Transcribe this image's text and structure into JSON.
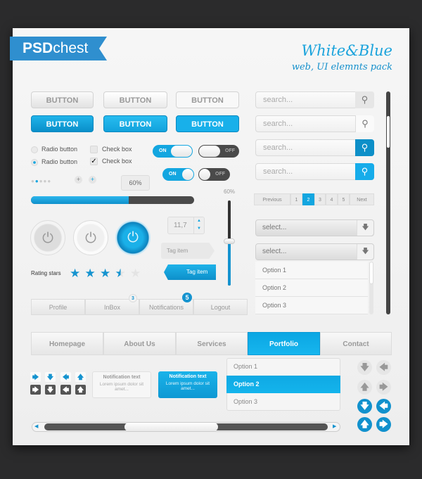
{
  "brand": {
    "logo_bold": "PSD",
    "logo_light": "chest",
    "title": "White&Blue",
    "subtitle": "web, UI elemnts pack"
  },
  "buttons": {
    "label": "BUTTON"
  },
  "search": {
    "placeholder": "search..."
  },
  "radios": [
    {
      "label": "Radio button",
      "checked": false
    },
    {
      "label": "Radio button",
      "checked": true
    }
  ],
  "checkboxes": [
    {
      "label": "Check box",
      "checked": false
    },
    {
      "label": "Check box",
      "checked": true
    }
  ],
  "toggles": {
    "on": "ON",
    "off": "OFF"
  },
  "progress": {
    "tooltip": "60%",
    "value": 60
  },
  "vslider": {
    "label": "60%",
    "value": 60
  },
  "pagination": {
    "prev": "Previous",
    "pages": [
      "1",
      "2",
      "3",
      "4",
      "5"
    ],
    "active": "2",
    "next": "Next"
  },
  "stepper": {
    "value": "11,7"
  },
  "tags": [
    "Tag item",
    "Tag item"
  ],
  "rating": {
    "label": "Rating stars",
    "value": 3.5,
    "max": 5
  },
  "selects": [
    "select...",
    "select..."
  ],
  "options": [
    "Option 1",
    "Option 2",
    "Option 3"
  ],
  "tabs": [
    {
      "label": "Profile"
    },
    {
      "label": "InBox",
      "badge": "3"
    },
    {
      "label": "Notifications",
      "badge": "5"
    },
    {
      "label": "Logout"
    }
  ],
  "nav": {
    "items": [
      "Homepage",
      "About Us",
      "Services",
      "Portfolio",
      "Contact"
    ],
    "active": "Portfolio"
  },
  "notifications": [
    {
      "title": "Notification text",
      "body": "Lorem ipsum dolor sit amet..."
    },
    {
      "title": "Notification text",
      "body": "Lorem ipsum dolor sit amet..."
    }
  ],
  "dropdown": {
    "options": [
      "Option 1",
      "Option 2",
      "Option 3"
    ],
    "selected": "Option 2"
  },
  "colors": {
    "accent": "#13a6e0",
    "panel": "#f2f2f2",
    "background": "#2b2b2c"
  }
}
